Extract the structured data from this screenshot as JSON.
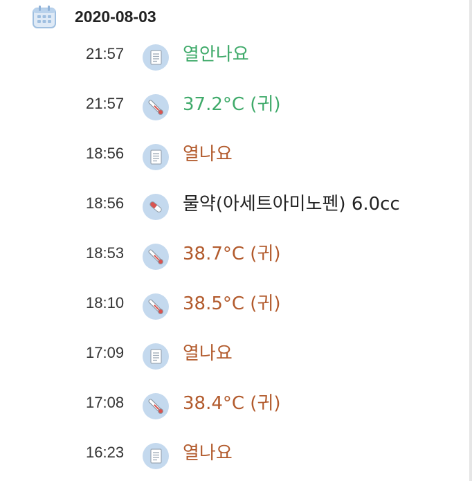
{
  "colors": {
    "green": "#3faa6a",
    "orange": "#b25a2c",
    "dark": "#222222",
    "icon_bg": "#c4d9ee"
  },
  "header": {
    "date": "2020-08-03",
    "icon": "calendar-icon"
  },
  "entries": [
    {
      "time": "21:57",
      "icon": "memo-icon",
      "text": "열안나요",
      "color": "green"
    },
    {
      "time": "21:57",
      "icon": "thermometer-icon",
      "text": "37.2°C (귀)",
      "color": "green"
    },
    {
      "time": "18:56",
      "icon": "memo-icon",
      "text": "열나요",
      "color": "orange"
    },
    {
      "time": "18:56",
      "icon": "pill-icon",
      "text": "물약(아세트아미노펜) 6.0cc",
      "color": "dark"
    },
    {
      "time": "18:53",
      "icon": "thermometer-icon",
      "text": "38.7°C (귀)",
      "color": "orange"
    },
    {
      "time": "18:10",
      "icon": "thermometer-icon",
      "text": "38.5°C (귀)",
      "color": "orange"
    },
    {
      "time": "17:09",
      "icon": "memo-icon",
      "text": "열나요",
      "color": "orange"
    },
    {
      "time": "17:08",
      "icon": "thermometer-icon",
      "text": "38.4°C (귀)",
      "color": "orange"
    },
    {
      "time": "16:23",
      "icon": "memo-icon",
      "text": "열나요",
      "color": "orange"
    }
  ]
}
